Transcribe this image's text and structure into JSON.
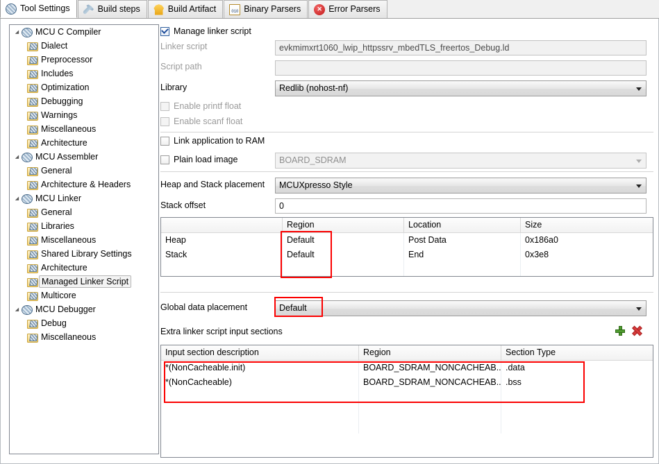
{
  "tabs": [
    {
      "label": "Tool Settings",
      "icon": "gear-ball-icon",
      "active": true
    },
    {
      "label": "Build steps",
      "icon": "wrench-icon",
      "active": false
    },
    {
      "label": "Build Artifact",
      "icon": "artifact-icon",
      "active": false
    },
    {
      "label": "Binary Parsers",
      "icon": "binary-file-icon",
      "active": false
    },
    {
      "label": "Error Parsers",
      "icon": "error-circle-icon",
      "active": false
    }
  ],
  "tree": [
    {
      "label": "MCU C Compiler",
      "level": 0,
      "icon": "tool-icon",
      "expanded": true,
      "selected": false
    },
    {
      "label": "Dialect",
      "level": 1,
      "icon": "folder-icon",
      "expanded": false,
      "selected": false
    },
    {
      "label": "Preprocessor",
      "level": 1,
      "icon": "folder-icon",
      "expanded": false,
      "selected": false
    },
    {
      "label": "Includes",
      "level": 1,
      "icon": "folder-icon",
      "expanded": false,
      "selected": false
    },
    {
      "label": "Optimization",
      "level": 1,
      "icon": "folder-icon",
      "expanded": false,
      "selected": false
    },
    {
      "label": "Debugging",
      "level": 1,
      "icon": "folder-icon",
      "expanded": false,
      "selected": false
    },
    {
      "label": "Warnings",
      "level": 1,
      "icon": "folder-icon",
      "expanded": false,
      "selected": false
    },
    {
      "label": "Miscellaneous",
      "level": 1,
      "icon": "folder-icon",
      "expanded": false,
      "selected": false
    },
    {
      "label": "Architecture",
      "level": 1,
      "icon": "folder-icon",
      "expanded": false,
      "selected": false
    },
    {
      "label": "MCU Assembler",
      "level": 0,
      "icon": "tool-icon",
      "expanded": true,
      "selected": false
    },
    {
      "label": "General",
      "level": 1,
      "icon": "folder-icon",
      "expanded": false,
      "selected": false
    },
    {
      "label": "Architecture & Headers",
      "level": 1,
      "icon": "folder-icon",
      "expanded": false,
      "selected": false
    },
    {
      "label": "MCU Linker",
      "level": 0,
      "icon": "tool-icon",
      "expanded": true,
      "selected": false
    },
    {
      "label": "General",
      "level": 1,
      "icon": "folder-icon",
      "expanded": false,
      "selected": false
    },
    {
      "label": "Libraries",
      "level": 1,
      "icon": "folder-icon",
      "expanded": false,
      "selected": false
    },
    {
      "label": "Miscellaneous",
      "level": 1,
      "icon": "folder-icon",
      "expanded": false,
      "selected": false
    },
    {
      "label": "Shared Library Settings",
      "level": 1,
      "icon": "folder-icon",
      "expanded": false,
      "selected": false
    },
    {
      "label": "Architecture",
      "level": 1,
      "icon": "folder-icon",
      "expanded": false,
      "selected": false
    },
    {
      "label": "Managed Linker Script",
      "level": 1,
      "icon": "folder-icon",
      "expanded": false,
      "selected": true
    },
    {
      "label": "Multicore",
      "level": 1,
      "icon": "folder-icon",
      "expanded": false,
      "selected": false
    },
    {
      "label": "MCU Debugger",
      "level": 0,
      "icon": "tool-icon",
      "expanded": true,
      "selected": false
    },
    {
      "label": "Debug",
      "level": 1,
      "icon": "folder-icon",
      "expanded": false,
      "selected": false
    },
    {
      "label": "Miscellaneous",
      "level": 1,
      "icon": "folder-icon",
      "expanded": false,
      "selected": false
    }
  ],
  "form": {
    "manage_linker_script": {
      "label": "Manage linker script",
      "checked": true
    },
    "linker_script": {
      "label": "Linker script",
      "value": "evkmimxrt1060_lwip_httpssrv_mbedTLS_freertos_Debug.ld"
    },
    "script_path": {
      "label": "Script path",
      "value": ""
    },
    "library": {
      "label": "Library",
      "value": "Redlib (nohost-nf)"
    },
    "enable_printf_float": {
      "label": "Enable printf float",
      "checked": false
    },
    "enable_scanf_float": {
      "label": "Enable scanf float",
      "checked": false
    },
    "link_application_to_ram": {
      "label": "Link application to RAM",
      "checked": false
    },
    "plain_load_image": {
      "label": "Plain load image",
      "value": "BOARD_SDRAM",
      "checked": false
    },
    "heap_stack_placement": {
      "label": "Heap and Stack placement",
      "value": "MCUXpresso Style"
    },
    "stack_offset": {
      "label": "Stack offset",
      "value": "0"
    },
    "global_data_placement": {
      "label": "Global data placement",
      "value": "Default"
    },
    "extra_sections_label": "Extra linker script input sections"
  },
  "heap_stack_table": {
    "columns": [
      "",
      "Region",
      "Location",
      "Size"
    ],
    "rows": [
      {
        "name": "Heap",
        "region": "Default",
        "location": "Post Data",
        "size": "0x186a0"
      },
      {
        "name": "Stack",
        "region": "Default",
        "location": "End",
        "size": "0x3e8"
      },
      {
        "name": "",
        "region": "",
        "location": "",
        "size": ""
      }
    ]
  },
  "sections_table": {
    "columns": [
      "Input section description",
      "Region",
      "Section Type"
    ],
    "rows": [
      {
        "desc": "*(NonCacheable.init)",
        "region": "BOARD_SDRAM_NONCACHEAB...",
        "type": ".data"
      },
      {
        "desc": "*(NonCacheable)",
        "region": "BOARD_SDRAM_NONCACHEAB...",
        "type": ".bss"
      },
      {
        "desc": "",
        "region": "",
        "type": ""
      },
      {
        "desc": "",
        "region": "",
        "type": ""
      },
      {
        "desc": "",
        "region": "",
        "type": ""
      }
    ]
  },
  "toolbar_icons": {
    "add": "plus-icon",
    "remove": "delete-x-icon"
  },
  "annotations": {
    "highlight_color": "#fb0000",
    "boxes": [
      {
        "name": "heap-stack-region-highlight"
      },
      {
        "name": "global-data-placement-highlight"
      },
      {
        "name": "extra-sections-rows-highlight"
      }
    ]
  }
}
